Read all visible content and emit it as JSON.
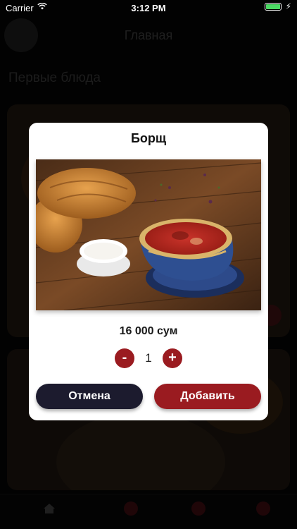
{
  "status_bar": {
    "carrier": "Carrier",
    "time": "3:12 PM",
    "battery_level": 1.0
  },
  "background": {
    "header_title": "Главная",
    "section_title": "Первые блюда"
  },
  "modal": {
    "title": "Борщ",
    "price": "16 000 сум",
    "quantity": "1",
    "minus_label": "-",
    "plus_label": "+",
    "cancel_label": "Отмена",
    "add_label": "Добавить"
  },
  "colors": {
    "accent": "#9a1b20",
    "dark_button": "#1c1b2e",
    "battery": "#4cd964"
  },
  "icons": [
    "wifi-icon",
    "battery-icon",
    "home-icon",
    "cart-icon"
  ]
}
